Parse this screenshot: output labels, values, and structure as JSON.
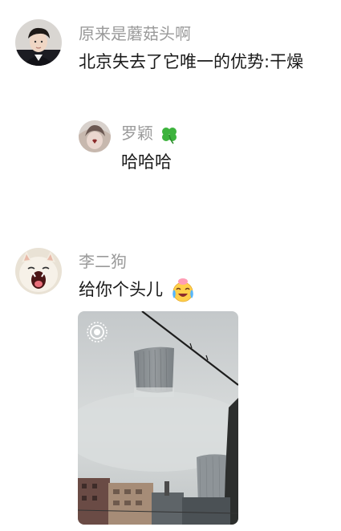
{
  "comments": [
    {
      "username": "原来是蘑菇头啊",
      "text": "北京失去了它唯一的优势:干燥"
    },
    {
      "username": "罗颖",
      "username_icon": "four-leaf-clover-icon",
      "text": "哈哈哈"
    },
    {
      "username": "李二狗",
      "text": "给你个头儿",
      "text_emoji": "crying-laughing-face-icon",
      "attachment": {
        "type": "image",
        "badge_icon": "live-photo-icon",
        "description_icon": "foggy-city-photo"
      }
    }
  ],
  "colors": {
    "username": "#9a9a9a",
    "text": "#1a1a1a",
    "background": "#ffffff"
  }
}
